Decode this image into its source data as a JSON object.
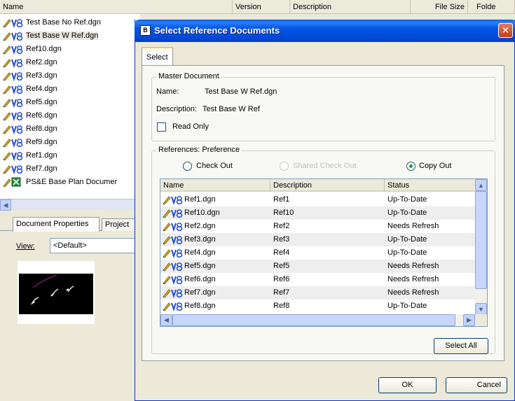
{
  "background": {
    "columns": [
      "Name",
      "Version",
      "Description",
      "File Size",
      "Folde"
    ],
    "files": [
      "Test Base No Ref.dgn",
      "Test Base W Ref.dgn",
      "Ref10.dgn",
      "Ref2.dgn",
      "Ref3.dgn",
      "Ref4.dgn",
      "Ref5.dgn",
      "Ref6.dgn",
      "Ref8.dgn",
      "Ref9.dgn",
      "Ref1.dgn",
      "Ref7.dgn",
      "PS&E Base Plan Documer"
    ],
    "tabs": [
      "Document Properties",
      "Project"
    ],
    "view_label": "View:",
    "view_value": "<Default>"
  },
  "dialog": {
    "title": "Select Reference Documents",
    "close_glyph": "✕",
    "tab": "Select",
    "master": {
      "group_label": "Master Document",
      "name_label": "Name:",
      "name_value": "Test Base W Ref.dgn",
      "description_label": "Description:",
      "description_value": "Test Base W Ref",
      "read_only_label": "Read Only"
    },
    "references": {
      "group_label": "References: Preference",
      "options": {
        "check_out": "Check Out",
        "shared_check_out": "Shared Check Out",
        "copy_out": "Copy Out"
      },
      "selected_option": "copy_out",
      "columns": [
        "Name",
        "Description",
        "Status"
      ],
      "rows": [
        {
          "name": "Ref1.dgn",
          "description": "Ref1",
          "status": "Up-To-Date"
        },
        {
          "name": "Ref10.dgn",
          "description": "Ref10",
          "status": "Up-To-Date"
        },
        {
          "name": "Ref2.dgn",
          "description": "Ref2",
          "status": "Needs Refresh"
        },
        {
          "name": "Ref3.dgn",
          "description": "Ref3",
          "status": "Up-To-Date"
        },
        {
          "name": "Ref4.dgn",
          "description": "Ref4",
          "status": "Up-To-Date"
        },
        {
          "name": "Ref5.dgn",
          "description": "Ref5",
          "status": "Needs Refresh"
        },
        {
          "name": "Ref6.dgn",
          "description": "Ref6",
          "status": "Needs Refresh"
        },
        {
          "name": "Ref7.dgn",
          "description": "Ref7",
          "status": "Needs Refresh"
        },
        {
          "name": "Ref8.dgn",
          "description": "Ref8",
          "status": "Up-To-Date"
        }
      ],
      "select_all_label": "Select All"
    },
    "ok_label": "OK",
    "cancel_label": "Cancel"
  },
  "icons": {
    "file_icon": "pencil-v8-icon",
    "excel_icon": "excel-icon",
    "dialog_icon": "dialog-icon",
    "close_icon": "close-icon"
  },
  "colors": {
    "titlebar": "#0055e5",
    "v8_blue": "#2250d8",
    "pencil_yellow": "#d8b020",
    "excel_green": "#1e8b3a"
  }
}
